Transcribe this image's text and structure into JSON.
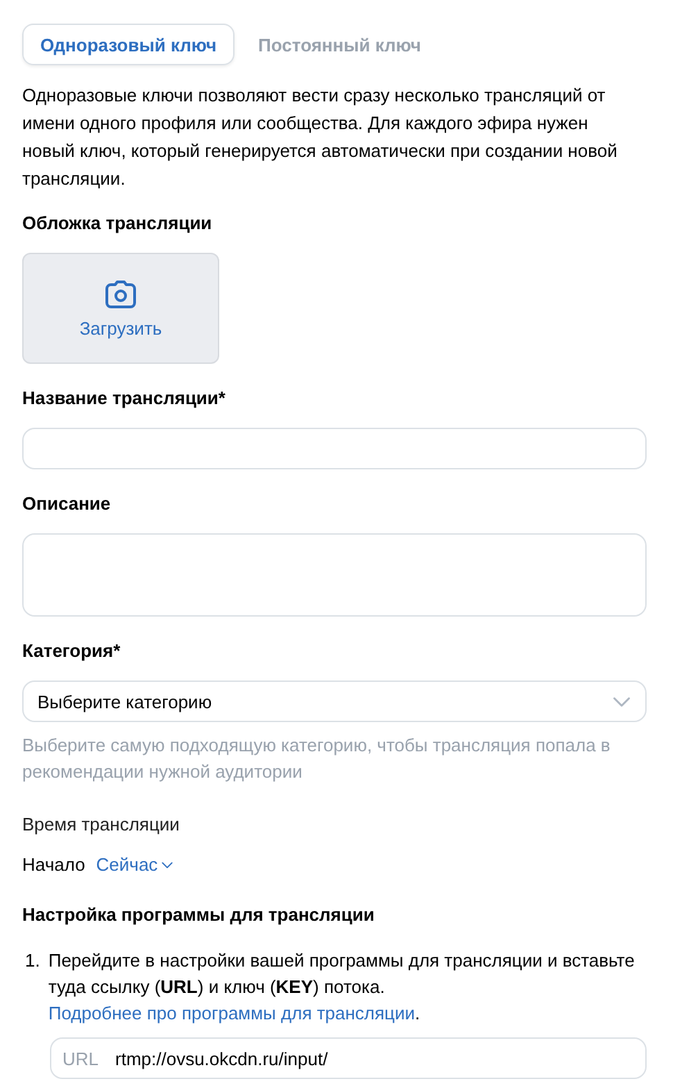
{
  "tabs": [
    {
      "label": "Одноразовый ключ",
      "selected": true
    },
    {
      "label": "Постоянный ключ",
      "selected": false
    }
  ],
  "intro": "Одноразовые ключи позволяют вести сразу несколько трансляций от имени одного профиля или сообщества. Для каждого эфира нужен новый ключ, который генерируется автоматически при создании новой трансляции.",
  "cover": {
    "label": "Обложка трансляции",
    "button": "Загрузить"
  },
  "fields": [
    {
      "kind": "text",
      "label": "Название трансляции*"
    },
    {
      "kind": "textarea",
      "label": "Описание"
    },
    {
      "kind": "select",
      "label": "Категория*",
      "value": "Выберите категорию",
      "hint": "Выберите самую подходящую категорию, чтобы трансляция попала в рекомендации нужной аудитории"
    }
  ],
  "time": {
    "label": "Время трансляции",
    "start_label": "Начало",
    "start_value": "Сейчас"
  },
  "setup": {
    "title": "Настройка программы для трансляции",
    "steps": [
      {
        "number": "1.",
        "text": "Перейдите в настройки вашей программы для трансляции и вставьте туда ссылку (**URL**) и ключ (**KEY**) потока. ",
        "link": "Подробнее про программы для трансляции",
        "after": "."
      }
    ],
    "url_field": {
      "label": "URL",
      "value": "rtmp://ovsu.okcdn.ru/input/"
    }
  }
}
